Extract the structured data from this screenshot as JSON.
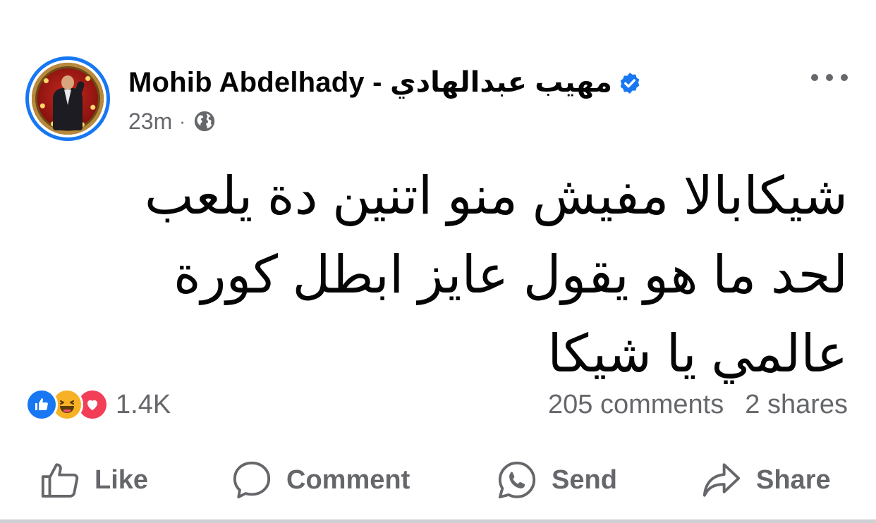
{
  "post": {
    "author": "Mohib Abdelhady - مهيب عبدالهادي",
    "time": "23m",
    "separator": "·",
    "privacy_icon": "globe-icon",
    "verified_icon": "verified-badge-icon",
    "more_icon": "more-options-icon",
    "text_lines": [
      "شيكابالا مفيش منو اتنين دة يلعب",
      "لحد ما هو يقول عايز ابطل كورة",
      "عالمي يا شيكا"
    ]
  },
  "stats": {
    "reaction_icons": [
      "like-reaction-icon",
      "haha-reaction-icon",
      "love-reaction-icon"
    ],
    "reactions_count": "1.4K",
    "comments": "205 comments",
    "shares": "2 shares"
  },
  "actions": {
    "like": "Like",
    "comment": "Comment",
    "send": "Send",
    "share": "Share"
  },
  "colors": {
    "brand_blue": "#1877f2",
    "secondary_text": "#65676b",
    "primary_text": "#050505",
    "haha_yellow": "#f7b125",
    "love_red": "#f33e58"
  }
}
